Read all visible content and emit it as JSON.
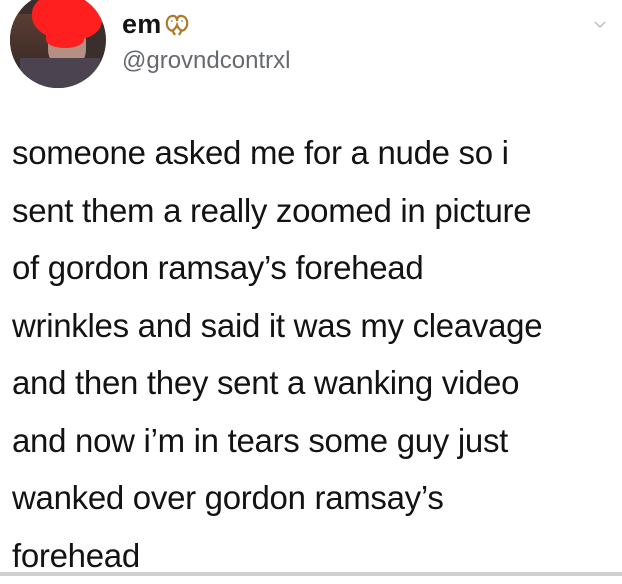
{
  "tweet": {
    "display_name": "em",
    "name_emoji_icon": "pretzel-icon",
    "handle": "@grovndcontrxl",
    "menu_icon": "chevron-down-icon",
    "text": "someone asked me for a nude so i sent them a really zoomed in picture of gordon ramsay’s forehead wrinkles and said it was my cleavage and then they sent a wanking video and now i’m in tears some guy just wanked over gordon ramsay’s forehead",
    "lines": [
      "someone asked me for a nude so i",
      "sent them a really zoomed in picture",
      "of gordon ramsay’s forehead",
      "wrinkles and said it was my cleavage",
      "and then they sent a wanking video",
      "and now i’m in tears some guy just",
      "wanked over gordon ramsay’s",
      "forehead"
    ]
  },
  "colors": {
    "background": "#ffffff",
    "text": "#131313",
    "handle": "#666a6e",
    "redaction": "#ff1f1f"
  }
}
